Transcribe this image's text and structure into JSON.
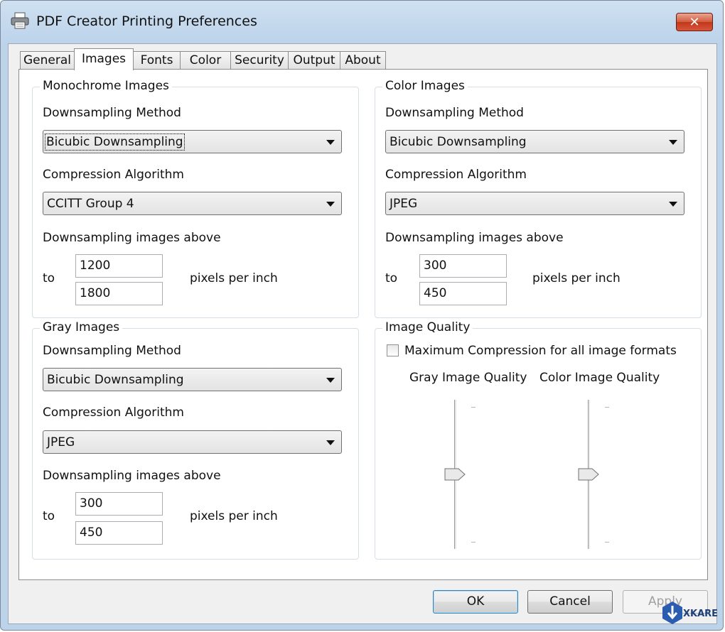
{
  "window": {
    "title": "PDF Creator Printing Preferences",
    "close_label": "✕"
  },
  "tabs": [
    {
      "label": "General"
    },
    {
      "label": "Images"
    },
    {
      "label": "Fonts"
    },
    {
      "label": "Color"
    },
    {
      "label": "Security"
    },
    {
      "label": "Output"
    },
    {
      "label": "About"
    }
  ],
  "monochrome": {
    "legend": "Monochrome Images",
    "downsampling_label": "Downsampling Method",
    "downsampling_value": "Bicubic Downsampling",
    "compression_label": "Compression Algorithm",
    "compression_value": "CCITT Group 4",
    "above_label": "Downsampling images above",
    "to_label": "to",
    "value_top": "1200",
    "value_bottom": "1800",
    "ppi_label": "pixels per inch"
  },
  "color": {
    "legend": "Color Images",
    "downsampling_label": "Downsampling Method",
    "downsampling_value": "Bicubic Downsampling",
    "compression_label": "Compression Algorithm",
    "compression_value": "JPEG",
    "above_label": "Downsampling images above",
    "to_label": "to",
    "value_top": "300",
    "value_bottom": "450",
    "ppi_label": "pixels per inch"
  },
  "gray": {
    "legend": "Gray Images",
    "downsampling_label": "Downsampling Method",
    "downsampling_value": "Bicubic Downsampling",
    "compression_label": "Compression Algorithm",
    "compression_value": "JPEG",
    "above_label": "Downsampling images above",
    "to_label": "to",
    "value_top": "300",
    "value_bottom": "450",
    "ppi_label": "pixels per inch"
  },
  "quality": {
    "legend": "Image Quality",
    "max_compression_label": "Maximum Compression for all image formats",
    "max_compression_checked": false,
    "gray_label": "Gray Image Quality",
    "color_label": "Color Image Quality",
    "gray_level": 0.5,
    "color_level": 0.5
  },
  "buttons": {
    "ok": "OK",
    "cancel": "Cancel",
    "apply": "Apply"
  },
  "watermark": {
    "text": "XKARE"
  },
  "colors": {
    "accent": "#3c7fb1",
    "close": "#c2391c",
    "frame": "#bcd3ea"
  }
}
